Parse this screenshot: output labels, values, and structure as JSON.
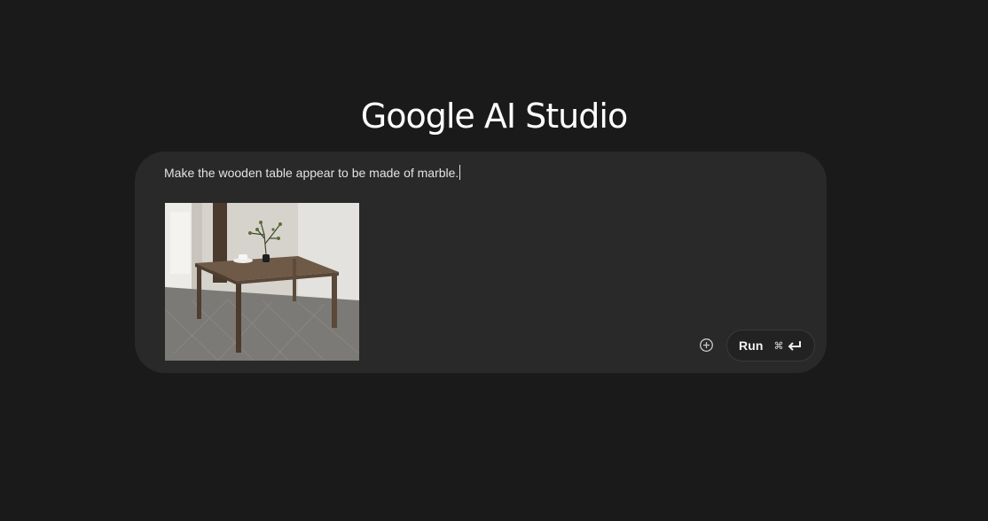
{
  "logo": {
    "text": "Google AI Studio"
  },
  "composer": {
    "prompt_value": "Make the wooden table appear to be made of marble.",
    "attachment_icon": "image-thumbnail",
    "add_icon": "plus-circle-icon",
    "run_label": "Run",
    "shortcut_cmd": "⌘",
    "shortcut_enter_icon": "enter-arrow-icon"
  }
}
